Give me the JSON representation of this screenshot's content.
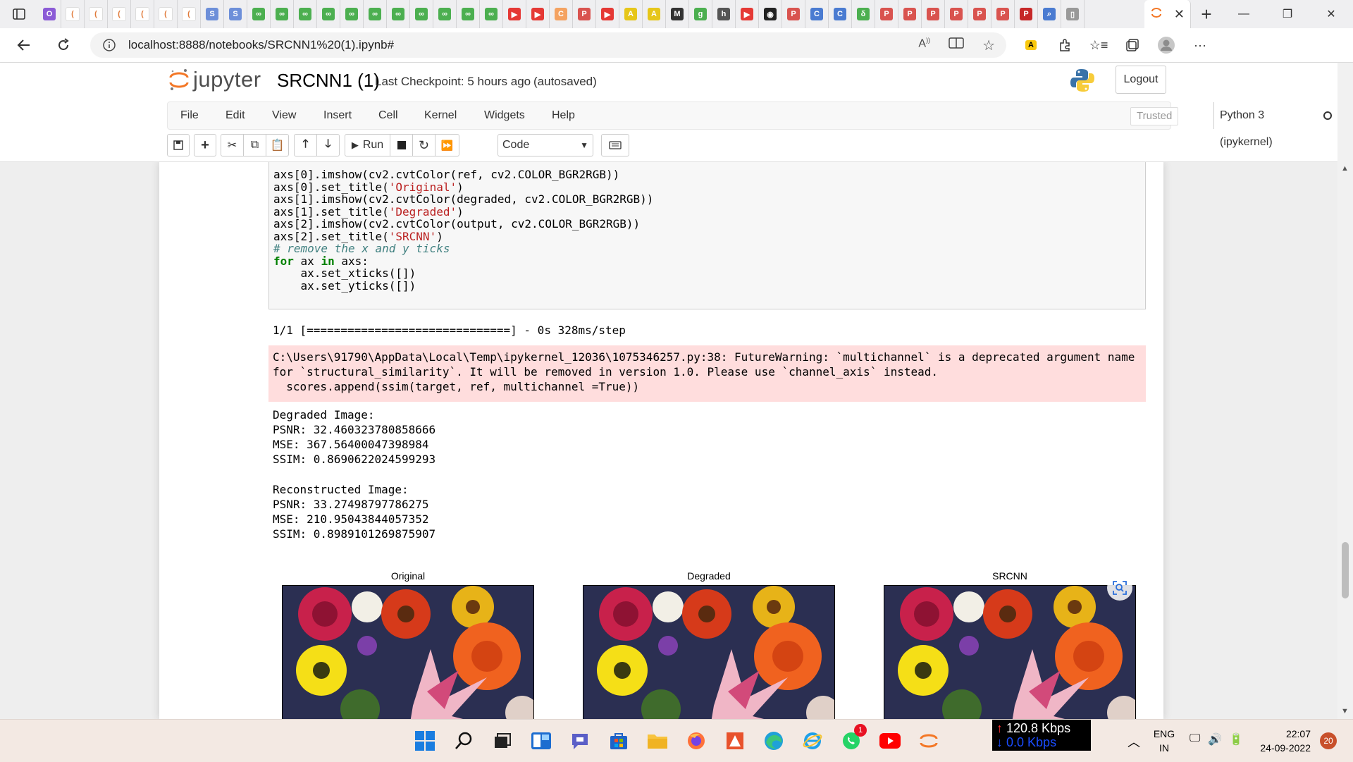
{
  "browser": {
    "url": "localhost:8888/notebooks/SRCNN1%20(1).ipynb#",
    "tabs": [
      {
        "icon": "onenote-icon",
        "color": "#8b5bd6",
        "glyph": "O"
      },
      {
        "icon": "loading-icon",
        "color": "#ffffff",
        "glyph": "("
      },
      {
        "icon": "loading-icon",
        "color": "#ffffff",
        "glyph": "("
      },
      {
        "icon": "loading-icon",
        "color": "#ffffff",
        "glyph": "("
      },
      {
        "icon": "loading-icon",
        "color": "#ffffff",
        "glyph": "("
      },
      {
        "icon": "loading-icon",
        "color": "#ffffff",
        "glyph": "("
      },
      {
        "icon": "loading-icon",
        "color": "#ffffff",
        "glyph": "("
      },
      {
        "icon": "s-icon",
        "color": "#6d8fd9",
        "glyph": "S"
      },
      {
        "icon": "s-icon",
        "color": "#6d8fd9",
        "glyph": "S"
      },
      {
        "icon": "link-icon",
        "color": "#4caf50",
        "glyph": "∞"
      },
      {
        "icon": "link-icon",
        "color": "#4caf50",
        "glyph": "∞"
      },
      {
        "icon": "link-icon",
        "color": "#4caf50",
        "glyph": "∞"
      },
      {
        "icon": "link-icon",
        "color": "#4caf50",
        "glyph": "∞"
      },
      {
        "icon": "link-icon",
        "color": "#4caf50",
        "glyph": "∞"
      },
      {
        "icon": "link-icon",
        "color": "#4caf50",
        "glyph": "∞"
      },
      {
        "icon": "link-icon",
        "color": "#4caf50",
        "glyph": "∞"
      },
      {
        "icon": "link-icon",
        "color": "#4caf50",
        "glyph": "∞"
      },
      {
        "icon": "link-icon",
        "color": "#4caf50",
        "glyph": "∞"
      },
      {
        "icon": "link-icon",
        "color": "#4caf50",
        "glyph": "∞"
      },
      {
        "icon": "link-icon",
        "color": "#4caf50",
        "glyph": "∞"
      },
      {
        "icon": "youtube-icon",
        "color": "#e53935",
        "glyph": "▶"
      },
      {
        "icon": "youtube-icon",
        "color": "#e53935",
        "glyph": "▶"
      },
      {
        "icon": "cert-icon",
        "color": "#f4a261",
        "glyph": "C"
      },
      {
        "icon": "pdf-icon",
        "color": "#d9534f",
        "glyph": "P"
      },
      {
        "icon": "youtube-icon",
        "color": "#e53935",
        "glyph": "▶"
      },
      {
        "icon": "a-icon",
        "color": "#e6c619",
        "glyph": "A"
      },
      {
        "icon": "a-icon",
        "color": "#e6c619",
        "glyph": "A"
      },
      {
        "icon": "m-icon",
        "color": "#333333",
        "glyph": "M"
      },
      {
        "icon": "g-icon",
        "color": "#4caf50",
        "glyph": "g"
      },
      {
        "icon": "h-icon",
        "color": "#555555",
        "glyph": "h"
      },
      {
        "icon": "youtube-icon",
        "color": "#e53935",
        "glyph": "▶"
      },
      {
        "icon": "github-icon",
        "color": "#222222",
        "glyph": "◉"
      },
      {
        "icon": "pdf-icon",
        "color": "#d9534f",
        "glyph": "P"
      },
      {
        "icon": "c-icon",
        "color": "#4a7bd1",
        "glyph": "C"
      },
      {
        "icon": "c-icon",
        "color": "#4a7bd1",
        "glyph": "C"
      },
      {
        "icon": "leaf-icon",
        "color": "#4caf50",
        "glyph": "δ"
      },
      {
        "icon": "pdf-icon",
        "color": "#d9534f",
        "glyph": "P"
      },
      {
        "icon": "pdf-icon",
        "color": "#d9534f",
        "glyph": "P"
      },
      {
        "icon": "pdf-icon",
        "color": "#d9534f",
        "glyph": "P"
      },
      {
        "icon": "pdf-icon",
        "color": "#d9534f",
        "glyph": "P"
      },
      {
        "icon": "pdf-icon",
        "color": "#d9534f",
        "glyph": "P"
      },
      {
        "icon": "pdf-icon",
        "color": "#d9534f",
        "glyph": "P"
      },
      {
        "icon": "pdf-icon",
        "color": "#c62828",
        "glyph": "P"
      },
      {
        "icon": "search-icon",
        "color": "#4a7bd1",
        "glyph": "⌕"
      },
      {
        "icon": "page-icon",
        "color": "#999999",
        "glyph": "▯"
      }
    ]
  },
  "jupyter": {
    "logo_text": "jupyter",
    "notebook_name": "SRCNN1 (1)",
    "checkpoint": "Last Checkpoint: 5 hours ago",
    "autosave": "(autosaved)",
    "logout": "Logout",
    "menu": [
      "File",
      "Edit",
      "View",
      "Insert",
      "Cell",
      "Kernel",
      "Widgets",
      "Help"
    ],
    "trusted": "Trusted",
    "kernel": "Python 3 (ipykernel)",
    "run_label": "Run",
    "cell_type": "Code"
  },
  "code_lines": [
    [
      {
        "t": "axs[0].imshow(cv2.cvtColor(ref, cv2.COLOR_BGR2RGB))",
        "c": "op"
      }
    ],
    [
      {
        "t": "axs[0].set_title(",
        "c": "op"
      },
      {
        "t": "'Original'",
        "c": "str"
      },
      {
        "t": ")",
        "c": "op"
      }
    ],
    [
      {
        "t": "axs[1].imshow(cv2.cvtColor(degraded, cv2.COLOR_BGR2RGB))",
        "c": "op"
      }
    ],
    [
      {
        "t": "axs[1].set_title(",
        "c": "op"
      },
      {
        "t": "'Degraded'",
        "c": "str"
      },
      {
        "t": ")",
        "c": "op"
      }
    ],
    [
      {
        "t": "axs[2].imshow(cv2.cvtColor(output, cv2.COLOR_BGR2RGB))",
        "c": "op"
      }
    ],
    [
      {
        "t": "axs[2].set_title(",
        "c": "op"
      },
      {
        "t": "'SRCNN'",
        "c": "str"
      },
      {
        "t": ")",
        "c": "op"
      }
    ],
    [
      {
        "t": "# remove the x and y ticks",
        "c": "cmt"
      }
    ],
    [
      {
        "t": "for",
        "c": "kw"
      },
      {
        "t": " ax ",
        "c": "op"
      },
      {
        "t": "in",
        "c": "kw"
      },
      {
        "t": " axs:",
        "c": "op"
      }
    ],
    [
      {
        "t": "    ax.set_xticks([])",
        "c": "op"
      }
    ],
    [
      {
        "t": "    ax.set_yticks([])",
        "c": "op"
      }
    ]
  ],
  "output": {
    "progress": "1/1 [==============================] - 0s 328ms/step",
    "stderr": [
      "C:\\Users\\91790\\AppData\\Local\\Temp\\ipykernel_12036\\1075346257.py:38: FutureWarning: `multichannel` is a deprecated argument name",
      "for `structural_similarity`. It will be removed in version 1.0. Please use `channel_axis` instead.",
      "  scores.append(ssim(target, ref, multichannel =True))"
    ],
    "stdout": [
      "Degraded Image:",
      "PSNR: 32.460323780858666",
      "MSE: 367.56400047398984",
      "SSIM: 0.8690622024599293",
      "",
      "Reconstructed Image:",
      "PSNR: 33.27498797786275",
      "MSE: 210.95043844057352",
      "SSIM: 0.8989101269875907"
    ],
    "figure_titles": [
      "Original",
      "Degraded",
      "SRCNN"
    ]
  },
  "taskbar": {
    "net_up": "120.8 Kbps",
    "net_down": "0.0 Kbps",
    "lang1": "ENG",
    "lang2": "IN",
    "time": "22:07",
    "date": "24-09-2022",
    "notifications": "20",
    "whatsapp_badge": "1"
  }
}
